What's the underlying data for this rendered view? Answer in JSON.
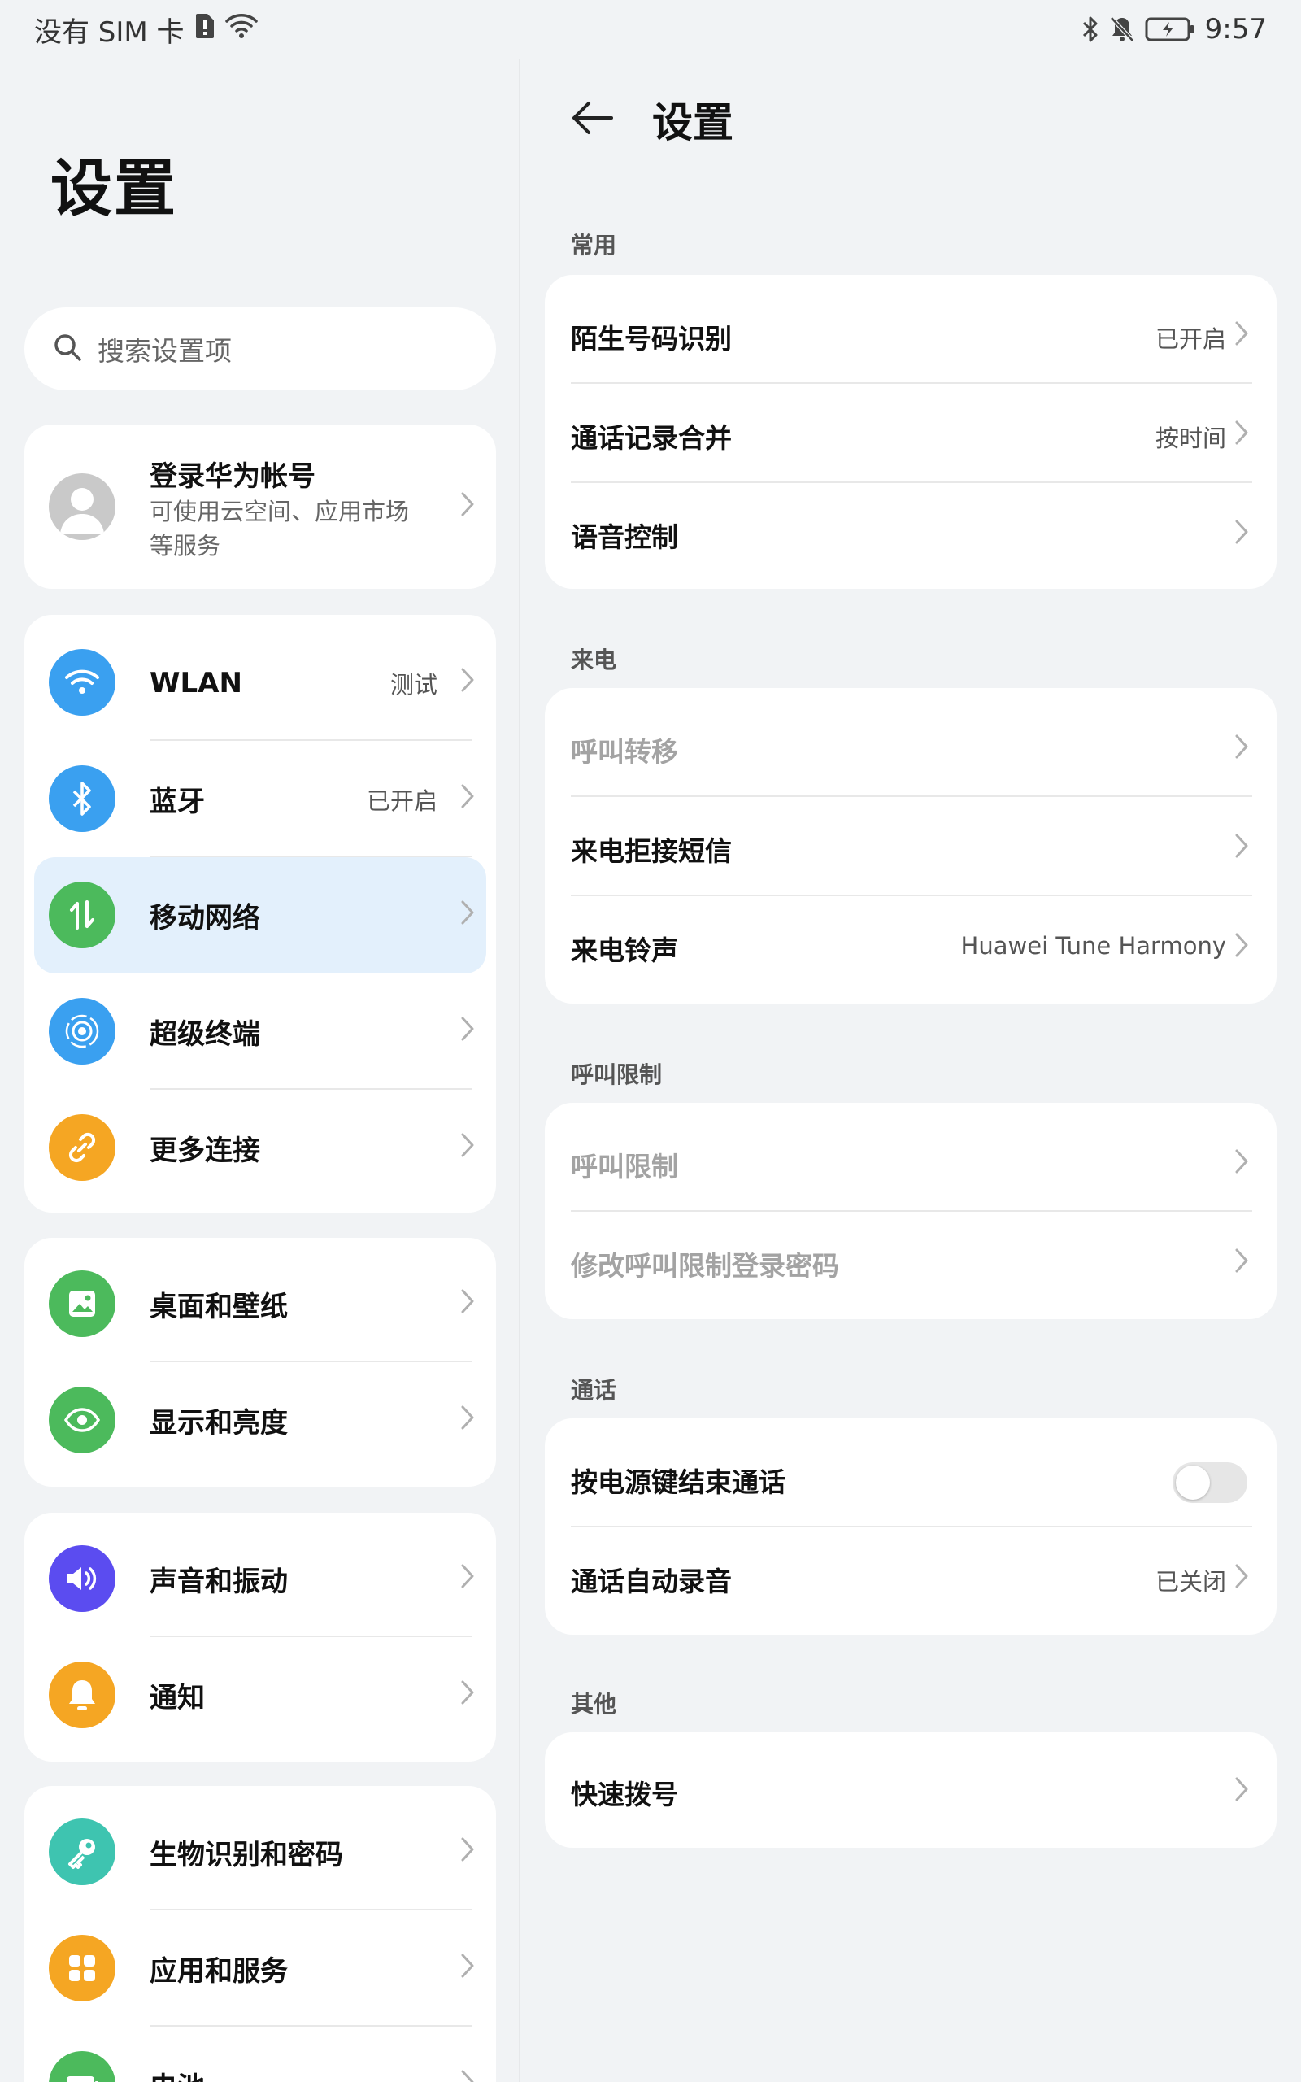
{
  "status_bar": {
    "carrier": "没有 SIM 卡",
    "time": "9:57",
    "icons": [
      "sim-alert-icon",
      "wifi-icon",
      "bluetooth-icon",
      "mute-bell-icon",
      "battery-charging-icon"
    ]
  },
  "left": {
    "title": "设置",
    "search_placeholder": "搜索设置项",
    "account": {
      "name": "登录华为帐号",
      "desc": "可使用云空间、应用市场等服务"
    },
    "group1": [
      {
        "label": "WLAN",
        "value": "测试",
        "icon": "wifi-icon",
        "color": "#3aa0f0"
      },
      {
        "label": "蓝牙",
        "value": "已开启",
        "icon": "bluetooth-icon",
        "color": "#3aa0f0"
      },
      {
        "label": "移动网络",
        "value": "",
        "icon": "mobile-data-icon",
        "color": "#4cba5c",
        "selected": true
      },
      {
        "label": "超级终端",
        "value": "",
        "icon": "super-device-icon",
        "color": "#3aa0f0"
      },
      {
        "label": "更多连接",
        "value": "",
        "icon": "link-icon",
        "color": "#f5a623"
      }
    ],
    "group2": [
      {
        "label": "桌面和壁纸",
        "icon": "wallpaper-icon",
        "color": "#4cba5c"
      },
      {
        "label": "显示和亮度",
        "icon": "eye-icon",
        "color": "#4cba5c"
      }
    ],
    "group3": [
      {
        "label": "声音和振动",
        "icon": "speaker-icon",
        "color": "#5b4cf0"
      },
      {
        "label": "通知",
        "icon": "bell-icon",
        "color": "#f5a623"
      }
    ],
    "group4": [
      {
        "label": "生物识别和密码",
        "icon": "key-icon",
        "color": "#3ec4b0"
      },
      {
        "label": "应用和服务",
        "icon": "apps-icon",
        "color": "#f5a623"
      },
      {
        "label": "电池",
        "icon": "battery-icon",
        "color": "#4cba5c"
      }
    ]
  },
  "right": {
    "title": "设置",
    "sections": [
      {
        "label": "常用",
        "rows": [
          {
            "label": "陌生号码识别",
            "value": "已开启"
          },
          {
            "label": "通话记录合并",
            "value": "按时间"
          },
          {
            "label": "语音控制",
            "value": ""
          }
        ]
      },
      {
        "label": "来电",
        "rows": [
          {
            "label": "呼叫转移",
            "value": "",
            "dim": true
          },
          {
            "label": "来电拒接短信",
            "value": ""
          },
          {
            "label": "来电铃声",
            "value": "Huawei Tune Harmony"
          }
        ]
      },
      {
        "label": "呼叫限制",
        "rows": [
          {
            "label": "呼叫限制",
            "value": "",
            "dim": true
          },
          {
            "label": "修改呼叫限制登录密码",
            "value": "",
            "dim": true
          }
        ]
      },
      {
        "label": "通话",
        "rows": [
          {
            "label": "按电源键结束通话",
            "toggle": false
          },
          {
            "label": "通话自动录音",
            "value": "已关闭"
          }
        ]
      },
      {
        "label": "其他",
        "rows": [
          {
            "label": "快速拨号",
            "value": ""
          }
        ]
      }
    ]
  },
  "colors": {
    "background": "#f1f3f5",
    "card": "#ffffff",
    "selected_highlight": "#e3f0fc"
  }
}
